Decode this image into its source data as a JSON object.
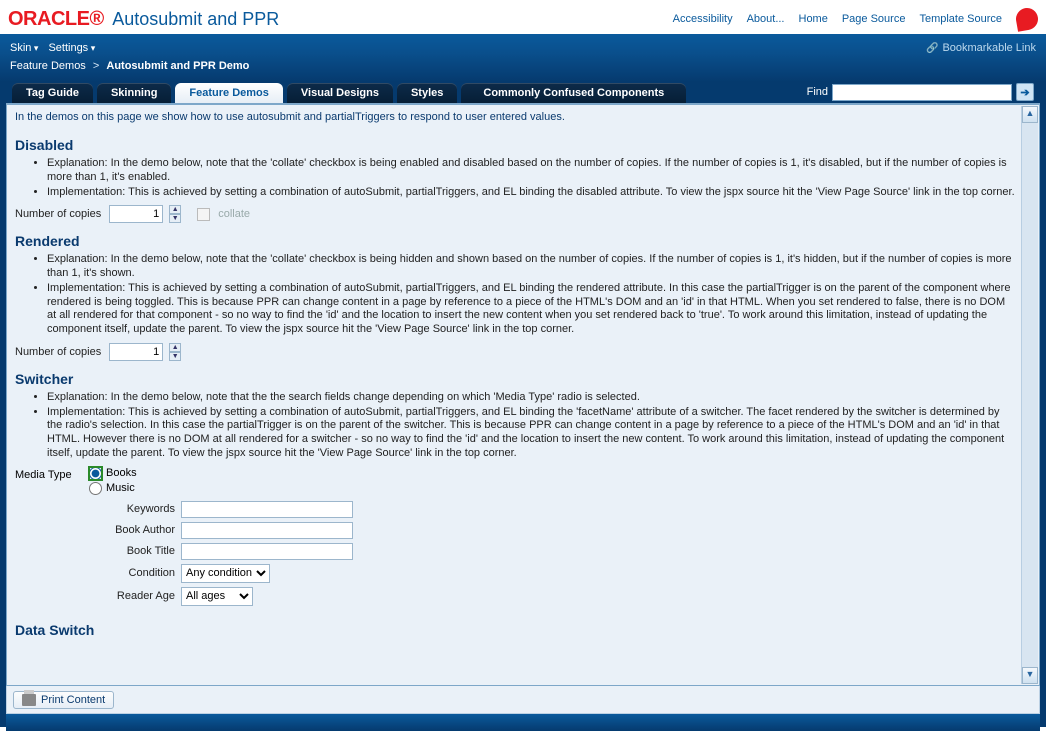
{
  "header": {
    "logo": "ORACLE",
    "title": "Autosubmit and PPR",
    "links": [
      "Accessibility",
      "About...",
      "Home",
      "Page Source",
      "Template Source"
    ]
  },
  "menubar": {
    "skin": "Skin",
    "settings": "Settings",
    "bookmark": "Bookmarkable Link"
  },
  "breadcrumb": {
    "root": "Feature Demos",
    "current": "Autosubmit and PPR Demo"
  },
  "tabs": [
    "Tag Guide",
    "Skinning",
    "Feature Demos",
    "Visual Designs",
    "Styles",
    "Commonly Confused Components"
  ],
  "active_tab_index": 2,
  "find": {
    "label": "Find",
    "value": ""
  },
  "intro": "In the demos on this page we show how to use autosubmit and partialTriggers to respond to user entered values.",
  "sections": {
    "disabled": {
      "title": "Disabled",
      "bullets": [
        "Explanation: In the demo below, note that the 'collate' checkbox is being enabled and disabled based on the number of copies. If the number of copies is 1, it's disabled, but if the number of copies is more than 1, it's enabled.",
        "Implementation: This is achieved by setting a combination of autoSubmit, partialTriggers, and EL binding the disabled attribute. To view the jspx source hit the 'View Page Source' link in the top corner."
      ],
      "copies_label": "Number of copies",
      "copies_value": "1",
      "collate_label": "collate"
    },
    "rendered": {
      "title": "Rendered",
      "bullets": [
        "Explanation: In the demo below, note that the 'collate' checkbox is being hidden and shown based on the number of copies. If the number of copies is 1, it's hidden, but if the number of copies is more than 1, it's shown.",
        "Implementation: This is achieved by setting a combination of autoSubmit, partialTriggers, and EL binding the rendered attribute. In this case the partialTrigger is on the parent of the component where rendered is being toggled. This is because PPR can change content in a page by reference to a piece of the HTML's DOM and an 'id' in that HTML. When you set rendered to false, there is no DOM at all rendered for that component - so no way to find the 'id' and the location to insert the new content when you set rendered back to 'true'. To work around this limitation, instead of updating the component itself, update the parent. To view the jspx source hit the 'View Page Source' link in the top corner."
      ],
      "copies_label": "Number of copies",
      "copies_value": "1"
    },
    "switcher": {
      "title": "Switcher",
      "bullets": [
        "Explanation: In the demo below, note that the the search fields change depending on which 'Media Type' radio is selected.",
        "Implementation: This is achieved by setting a combination of autoSubmit, partialTriggers, and EL binding the 'facetName' attribute of a switcher. The facet rendered by the switcher is determined by the radio's selection. In this case the partialTrigger is on the parent of the switcher. This is because PPR can change content in a page by reference to a piece of the HTML's DOM and an 'id' in that HTML. However there is no DOM at all rendered for a switcher - so no way to find the 'id' and the location to insert the new content. To work around this limitation, instead of updating the component itself, update the parent. To view the jspx source hit the 'View Page Source' link in the top corner."
      ],
      "media_label": "Media Type",
      "radios": [
        "Books",
        "Music"
      ],
      "selected_radio": 0,
      "fields": {
        "keywords": "Keywords",
        "author": "Book Author",
        "title": "Book Title",
        "condition": "Condition",
        "condition_value": "Any condition",
        "age": "Reader Age",
        "age_value": "All ages"
      }
    },
    "dataswitch_title": "Data Switch"
  },
  "print_label": "Print Content"
}
